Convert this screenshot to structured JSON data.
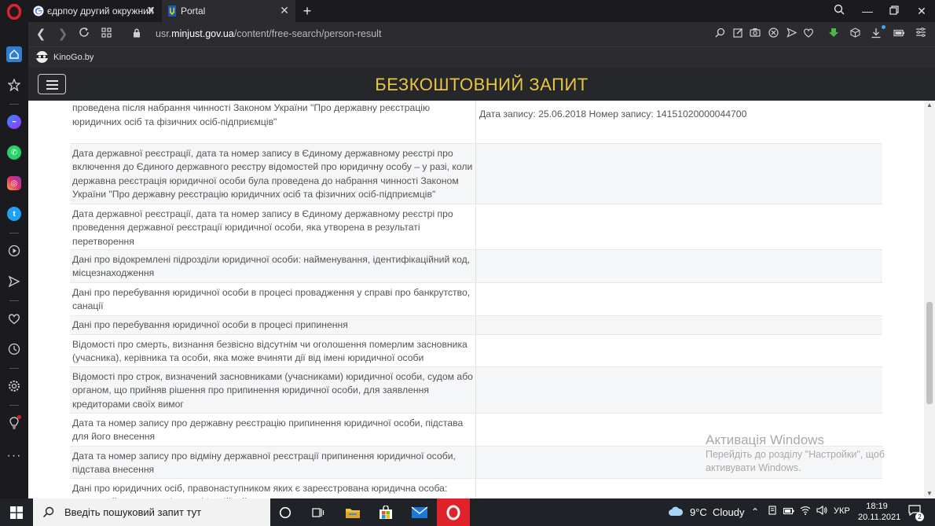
{
  "browser": {
    "tabs": [
      {
        "label": "єдрпоу другий окружний",
        "favicon": "google-icon",
        "active": false
      },
      {
        "label": "Portal",
        "favicon": "ukraine-trident-icon",
        "active": true
      }
    ],
    "url_prefix": "usr.",
    "url_domain": "minjust.gov.ua",
    "url_path": "/content/free-search/person-result",
    "bookmark": "KinoGo.by"
  },
  "site": {
    "title": "БЕЗКОШТОВНИЙ ЗАПИТ"
  },
  "table": {
    "rows": [
      {
        "label": "реєстрації юридичної особи – у разі, коли державна реєстрація юридичної особи була проведена після набрання чинності Законом України \"Про державну реєстрацію юридичних осіб та фізичних осіб-підприємців\"",
        "value": "Дата запису: 25.06.2018 Номер запису: 14151020000044700"
      },
      {
        "label": "Дата державної реєстрації, дата та номер запису в Єдиному державному реєстрі про включення до Єдиного державного реєстру відомостей про юридичну особу – у разі, коли державна реєстрація юридичної особи була проведена до набрання чинності Законом України \"Про державну реєстрацію юридичних осіб та фізичних осіб-підприємців\"",
        "value": ""
      },
      {
        "label": "Дата державної реєстрації, дата та номер запису в Єдиному державному реєстрі про проведення державної реєстрації юридичної особи, яка утворена в результаті перетворення",
        "value": ""
      },
      {
        "label": "Дані про відокремлені підрозділи юридичної особи: найменування, ідентифікаційний код, місцезнаходження",
        "value": ""
      },
      {
        "label": "Дані про перебування юридичної особи в процесі провадження у справі про банкрутство, санації",
        "value": ""
      },
      {
        "label": "Дані про перебування юридичної особи в процесі припинення",
        "value": ""
      },
      {
        "label": "Відомості про смерть, визнання безвісно відсутнім чи оголошення померлим засновника (учасника), керівника та особи, яка може вчиняти дії від імені юридичної особи",
        "value": ""
      },
      {
        "label": "Відомості про строк, визначений засновниками (учасниками) юридичної особи, судом або органом, що прийняв рішення про припинення юридичної особи, для заявлення кредиторами своїх вимог",
        "value": ""
      },
      {
        "label": "Дата та номер запису про державну реєстрацію припинення юридичної особи, підстава для його внесення",
        "value": ""
      },
      {
        "label": "Дата та номер запису про відміну державної реєстрації припинення юридичної особи, підстава внесення",
        "value": ""
      },
      {
        "label": "Дані про юридичних осіб, правонаступником яких є зареєстрована юридична особа: повне найменування, ідентифікаційний код",
        "value": ""
      }
    ]
  },
  "watermark": {
    "title": "Активація Windows",
    "subtitle": "Перейдіть до розділу \"Настройки\", щоб активувати Windows."
  },
  "taskbar": {
    "search_placeholder": "Введіть пошуковий запит тут",
    "weather": "9°C  Cloudy",
    "lang": "УКР",
    "time": "18:19",
    "date": "20.11.2021",
    "notifications": "2"
  },
  "colors": {
    "site_title": "#e9c63f",
    "header_bg": "#25272b",
    "browser_bg": "#2b2b30",
    "opera_red": "#e0222b"
  }
}
